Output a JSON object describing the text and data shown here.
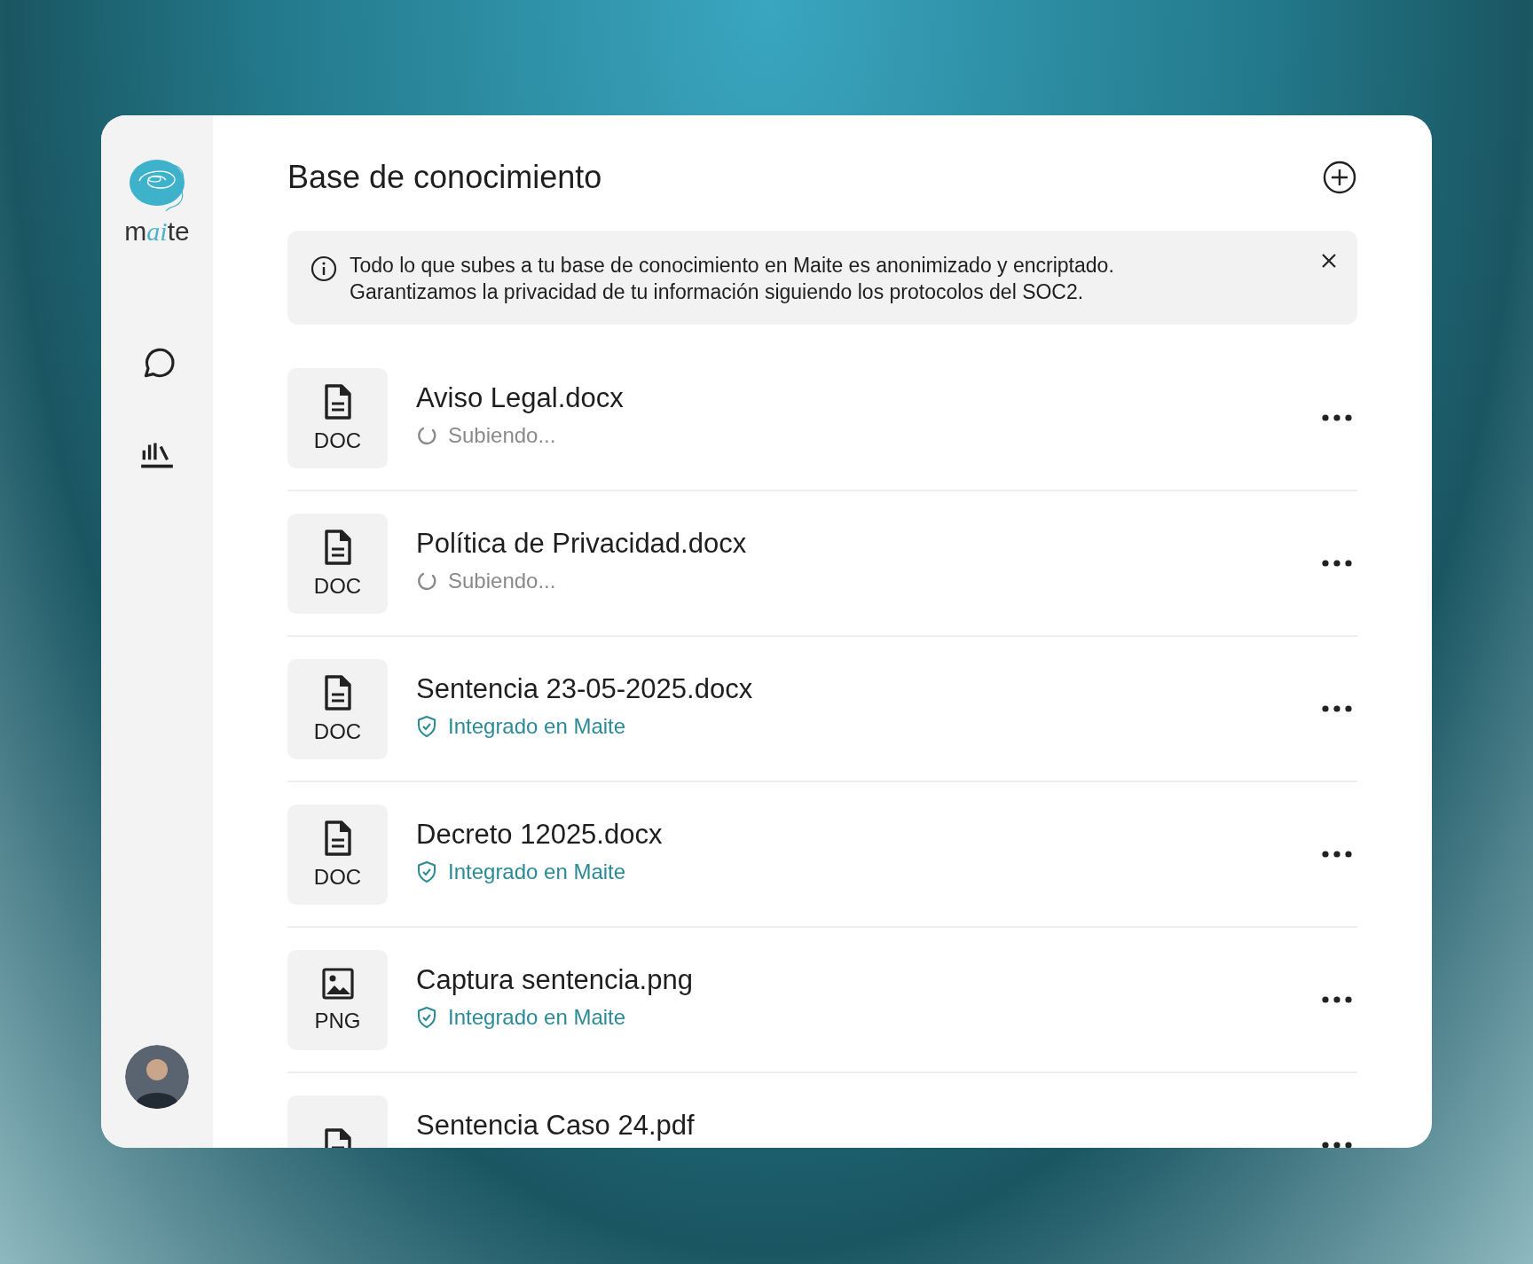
{
  "sidebar": {
    "logo": [
      "m",
      "ai",
      "te"
    ],
    "nav": [
      {
        "kind": "chat",
        "selected": false
      },
      {
        "kind": "stats",
        "selected": false
      }
    ]
  },
  "header": {
    "title": "Base de conocimiento"
  },
  "notice": {
    "lines": [
      "Todo lo que subes a tu base de conocimiento en Maite es anonimizado y encriptado.",
      "Garantizamos la privacidad de tu información siguiendo los protocolos del SOC2."
    ]
  },
  "files": [
    {
      "name": "Aviso Legal.docx",
      "type": "DOC",
      "kind": "doc",
      "status": {
        "kind": "uploading",
        "text": "Subiendo..."
      }
    },
    {
      "name": "Política de Privacidad.docx",
      "type": "DOC",
      "kind": "doc",
      "status": {
        "kind": "uploading",
        "text": "Subiendo..."
      }
    },
    {
      "name": "Sentencia 23-05-2025.docx",
      "type": "DOC",
      "kind": "doc",
      "status": {
        "kind": "integrated",
        "text": "Integrado en Maite"
      }
    },
    {
      "name": "Decreto 12025.docx",
      "type": "DOC",
      "kind": "doc",
      "status": {
        "kind": "integrated",
        "text": "Integrado en Maite"
      }
    },
    {
      "name": "Captura sentencia.png",
      "type": "PNG",
      "kind": "image",
      "status": {
        "kind": "integrated",
        "text": "Integrado en Maite"
      }
    },
    {
      "name": "Sentencia Caso 24.pdf",
      "kind": "doc"
    }
  ]
}
